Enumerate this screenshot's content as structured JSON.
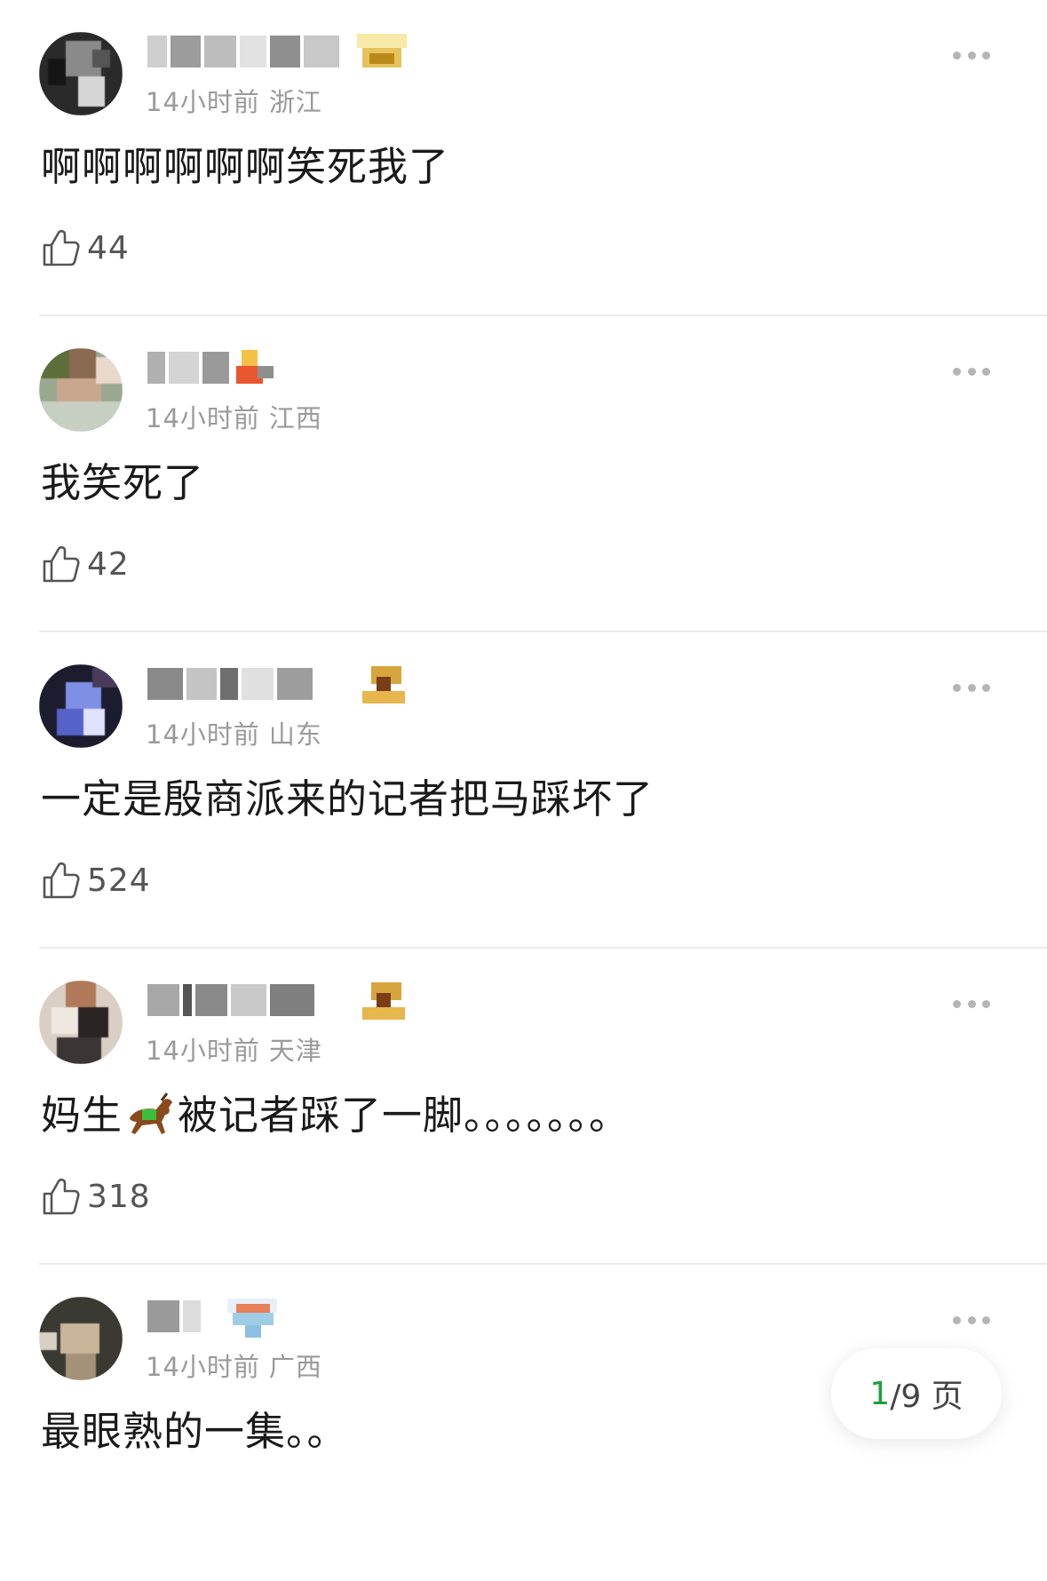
{
  "comments": [
    {
      "time": "14小时前",
      "region": "浙江",
      "text": "啊啊啊啊啊啊笑死我了",
      "likes": "44"
    },
    {
      "time": "14小时前",
      "region": "江西",
      "text": "我笑死了",
      "likes": "42"
    },
    {
      "time": "14小时前",
      "region": "山东",
      "text": "一定是殷商派来的记者把马踩坏了",
      "likes": "524"
    },
    {
      "time": "14小时前",
      "region": "天津",
      "text_before": "妈生",
      "text_after": "被记者踩了一脚。。。。。。。",
      "likes": "318"
    },
    {
      "time": "14小时前",
      "region": "广西",
      "text": "最眼熟的一集。。"
    }
  ],
  "pager": {
    "current": "1",
    "rest": "/9 页"
  },
  "colors": {
    "accent_green": "#1f9e3a",
    "meta_gray": "#9a9a9a",
    "divider": "#ebebeb"
  },
  "icons": {
    "like": "thumbs-up-outline-icon",
    "more": "more-dots-icon",
    "horse": "horse-emoji"
  }
}
